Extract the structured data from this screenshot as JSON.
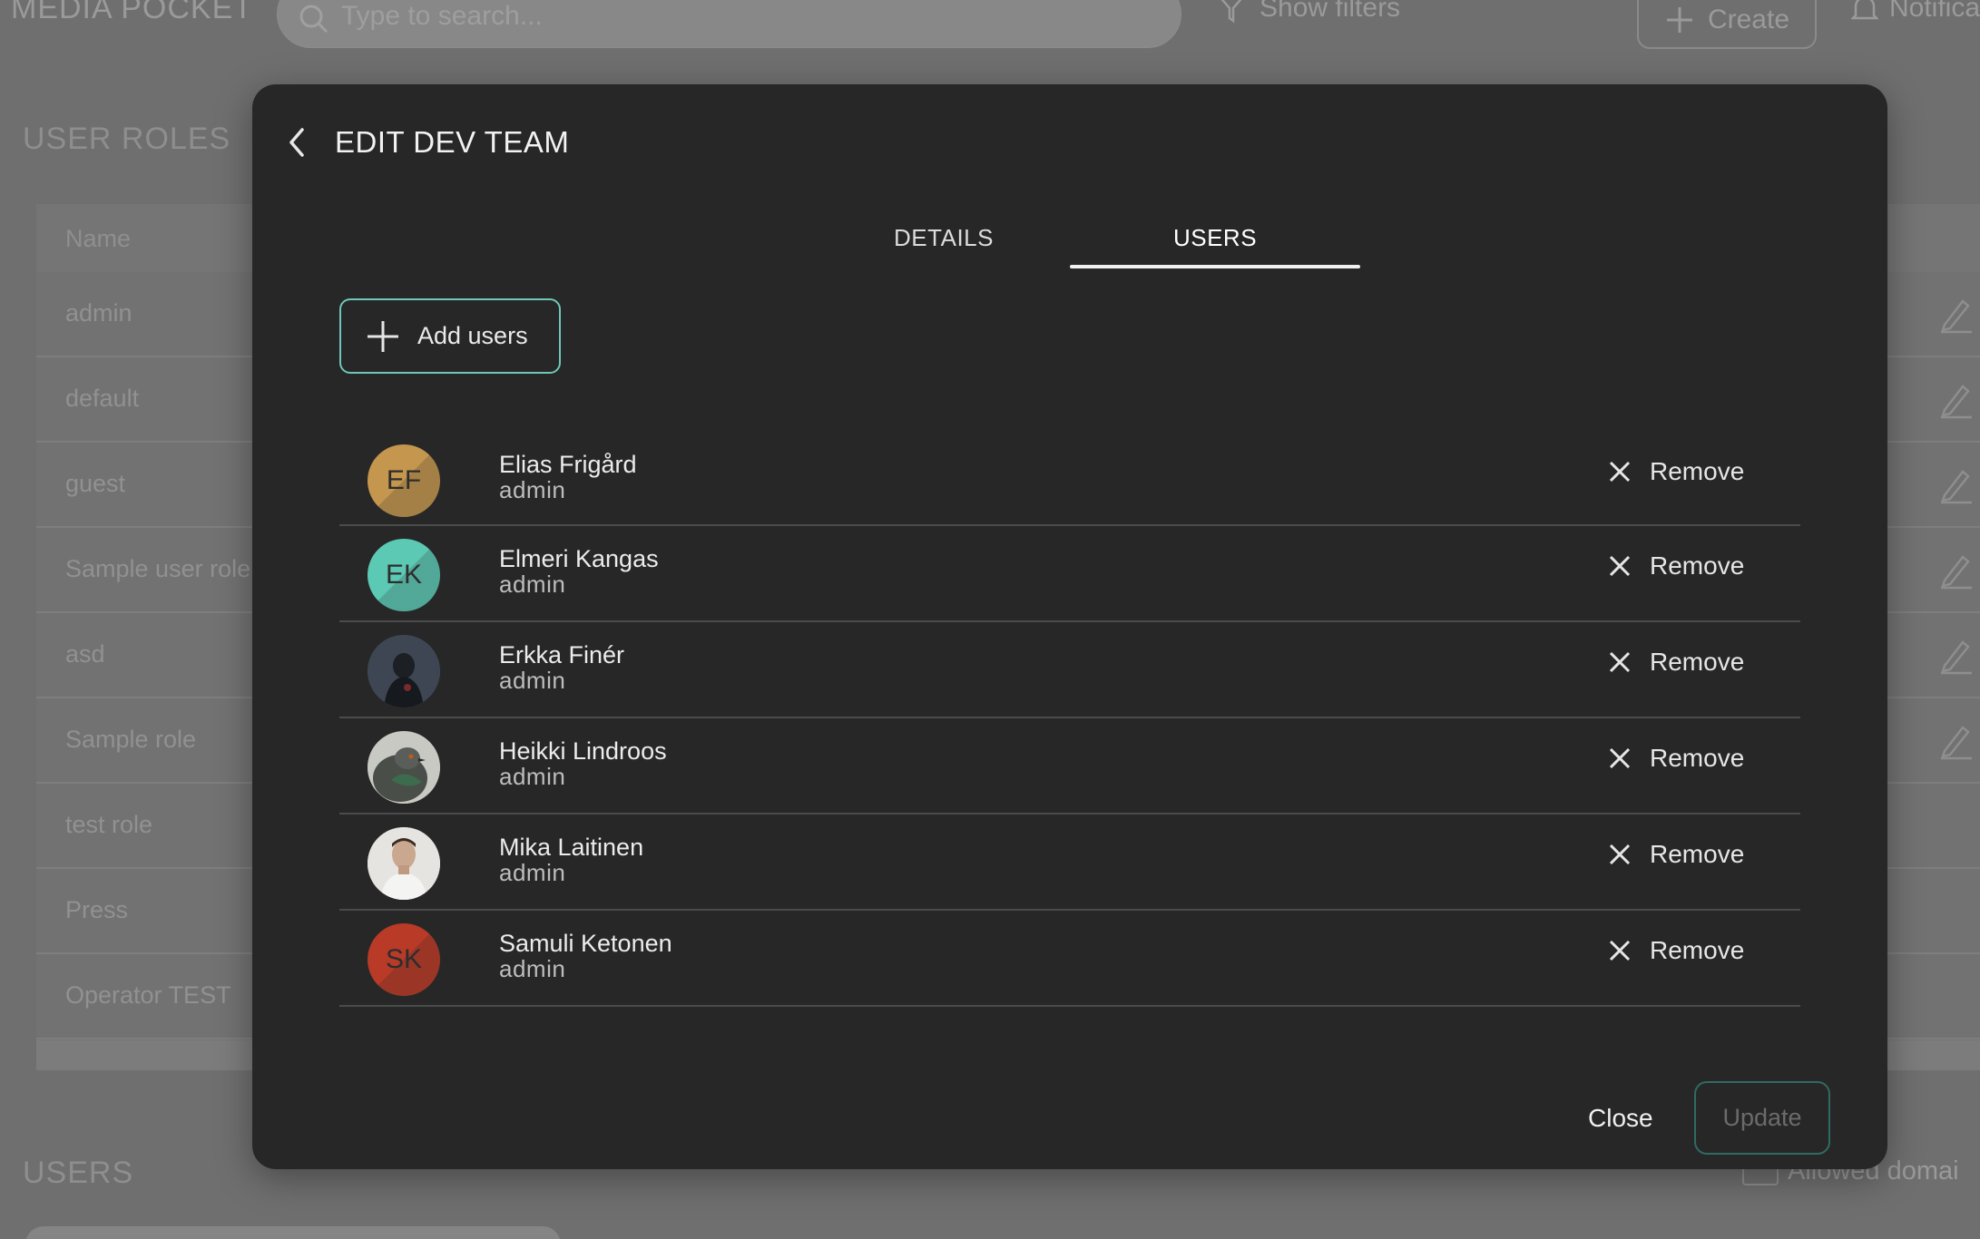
{
  "app": {
    "brand": "MEDIA POCKET",
    "search_placeholder": "Type to search...",
    "show_filters": "Show filters",
    "create": "Create",
    "notifications": "Notificati"
  },
  "background": {
    "user_roles_title": "USER ROLES",
    "name_header": "Name",
    "roles": [
      "admin",
      "default",
      "guest",
      "Sample user role",
      "asd",
      "Sample role",
      "test role",
      "Press",
      "Operator TEST"
    ],
    "users_title": "USERS",
    "allowed_domains": "Allowed domai"
  },
  "modal": {
    "title": "EDIT DEV TEAM",
    "tabs": [
      {
        "label": "DETAILS",
        "active": false
      },
      {
        "label": "USERS",
        "active": true
      }
    ],
    "add_users": "Add users",
    "remove_label": "Remove",
    "users": [
      {
        "initials": "EF",
        "name": "Elias Frigård",
        "role": "admin",
        "avatar_color": "#c4964e",
        "avatar_type": "initials"
      },
      {
        "initials": "EK",
        "name": "Elmeri Kangas",
        "role": "admin",
        "avatar_color": "#5cc9b4",
        "avatar_type": "initials"
      },
      {
        "initials": "",
        "name": "Erkka Finér",
        "role": "admin",
        "avatar_color": "#3a4450",
        "avatar_type": "photo"
      },
      {
        "initials": "",
        "name": "Heikki Lindroos",
        "role": "admin",
        "avatar_color": "#7a7e76",
        "avatar_type": "photo"
      },
      {
        "initials": "",
        "name": "Mika Laitinen",
        "role": "admin",
        "avatar_color": "#d8d6d2",
        "avatar_type": "photo"
      },
      {
        "initials": "SK",
        "name": "Samuli Ketonen",
        "role": "admin",
        "avatar_color": "#b83a27",
        "avatar_type": "initials"
      }
    ],
    "close": "Close",
    "update": "Update"
  },
  "colors": {
    "modal_bg": "#272727",
    "accent_teal": "#6fc7b9",
    "overlay": "#6f6f6f"
  }
}
